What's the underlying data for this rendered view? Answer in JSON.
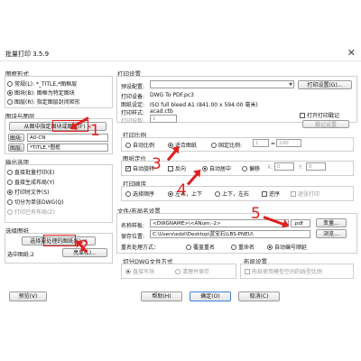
{
  "window": {
    "title": "批量打印 3.5.9",
    "close": "✕"
  },
  "left": {
    "frame_style": {
      "title": "图框形式",
      "options": [
        "常规(L): *_TITLE,*图框层",
        "图块(B): 图框为特定图块",
        "图层(R): 指定图层封闭矩形"
      ],
      "selected": 1
    },
    "block_name": {
      "title": "图块与图层",
      "pick_button": "从图中指定图块或图层(F) <",
      "block_label": "图块:",
      "block_value": "A0-CN",
      "layer_label": "图层:",
      "layer_value": "*TITLE,*图框"
    },
    "output": {
      "title": "输出选项",
      "options": [
        "直接批量打印(E)",
        "直接生成布局(Y)",
        "打印时文件(S)",
        "切分为单张DWG(Q)",
        "打印已有布局(Z)"
      ],
      "selected": 2,
      "disabled": [
        4
      ]
    },
    "select": {
      "title": "选择图纸",
      "select_button": "选择要处理的图纸(S) <",
      "count_label": "选中图纸:2",
      "preview_button": "亮显(L)..."
    },
    "preview_button": "预览(V)"
  },
  "right": {
    "print_setup": {
      "title": "打印设置",
      "preset_label": "预设配置:",
      "preset_value": "",
      "print_settings_button": "打印设置(G)...",
      "device_label": "打印设备:",
      "device_value": "DWG To PDF.pc3",
      "paper_label": "图纸设定:",
      "paper_value": "ISO full bleed A1 (841.00 x 594.00 毫米)",
      "style_label": "打印样式:",
      "style_value": "acad.ctb",
      "copies_label": "打印份数:",
      "copies_value": "1",
      "print_stamp": "打开打印戳记",
      "stamp_button": "戳记设置"
    },
    "scale": {
      "title": "打印比例",
      "auto": "自动比例",
      "fit": "适合图纸",
      "fixed": "固定比例:",
      "fixed_a": "1",
      "fixed_eq": "=",
      "fixed_b": "100"
    },
    "position": {
      "title": "图纸定位",
      "auto_rotate": "自动旋转",
      "reverse": "反向",
      "center": "自动居中",
      "offset": "偏移",
      "x_label": "X:",
      "x_value": "0",
      "y_label": "Y:",
      "y_value": "0"
    },
    "order": {
      "title": "打印顺序",
      "select_order": "选择顺序",
      "lr_tb": "左右，上下",
      "tb_lr": "上下，左右",
      "reverse": "逆序",
      "separate": "逐张打印"
    },
    "files": {
      "title": "文件/布局名设置",
      "name_label": "名称样板:",
      "name_value": "<DWGNAME>\\<ANum:-2>",
      "ext_value": ".pdf",
      "var_button": "变量...",
      "save_label": "保存位置:",
      "save_value": "C:\\Users\\edzl\\Desktop\\蓝宝石\\LBS-PNEU\\",
      "browse_button": "浏览...",
      "dup_label": "重名处理方式：",
      "dup_options": [
        "覆盖重名",
        "重命名",
        "自动编号顺延"
      ],
      "dup_selected": 2
    },
    "split": {
      "title": "切分DWG文件方式",
      "options": [
        "直接写块",
        "清理并保存"
      ],
      "selected": 0
    },
    "layout": {
      "title": "布局设置",
      "use_model_linetype": "布局使用模型空间的线型比例"
    }
  },
  "bottom": {
    "help": "帮助(H)",
    "ok": "确定(O)",
    "cancel": "取消(C)"
  },
  "annotations": {
    "n1": "1",
    "n2": "2",
    "n3": "3",
    "n4": "4",
    "n5": "5"
  },
  "colors": {
    "accent": "#e01e1e",
    "default_button_border": "#3c7fd6"
  }
}
